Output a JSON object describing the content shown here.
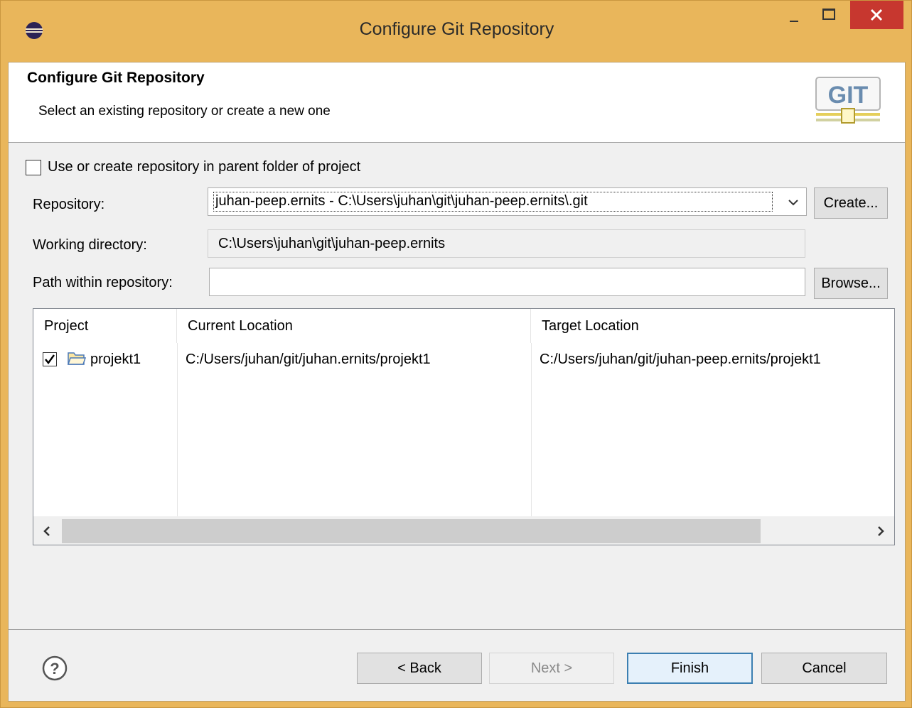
{
  "window": {
    "title": "Configure Git Repository",
    "accent_color": "#e9b65b",
    "close_color": "#c7372f"
  },
  "header": {
    "title": "Configure Git Repository",
    "description": "Select an existing repository or create a new one",
    "logo_text": "GIT"
  },
  "options": {
    "use_parent_folder": {
      "label": "Use or create repository in parent folder of project",
      "checked": false
    }
  },
  "form": {
    "repository_label": "Repository:",
    "repository_value": "juhan-peep.ernits - C:\\Users\\juhan\\git\\juhan-peep.ernits\\.git",
    "create_button": "Create...",
    "working_directory_label": "Working directory:",
    "working_directory_value": "C:\\Users\\juhan\\git\\juhan-peep.ernits",
    "path_label": "Path within repository:",
    "path_value": "",
    "browse_button": "Browse..."
  },
  "table": {
    "columns": [
      "Project",
      "Current Location",
      "Target Location"
    ],
    "rows": [
      {
        "checked": true,
        "project": "projekt1",
        "current_location": "C:/Users/juhan/git/juhan.ernits/projekt1",
        "target_location": "C:/Users/juhan/git/juhan-peep.ernits/projekt1"
      }
    ]
  },
  "footer": {
    "help_icon": "question-mark-icon",
    "back_button": "< Back",
    "next_button": "Next >",
    "finish_button": "Finish",
    "cancel_button": "Cancel"
  }
}
